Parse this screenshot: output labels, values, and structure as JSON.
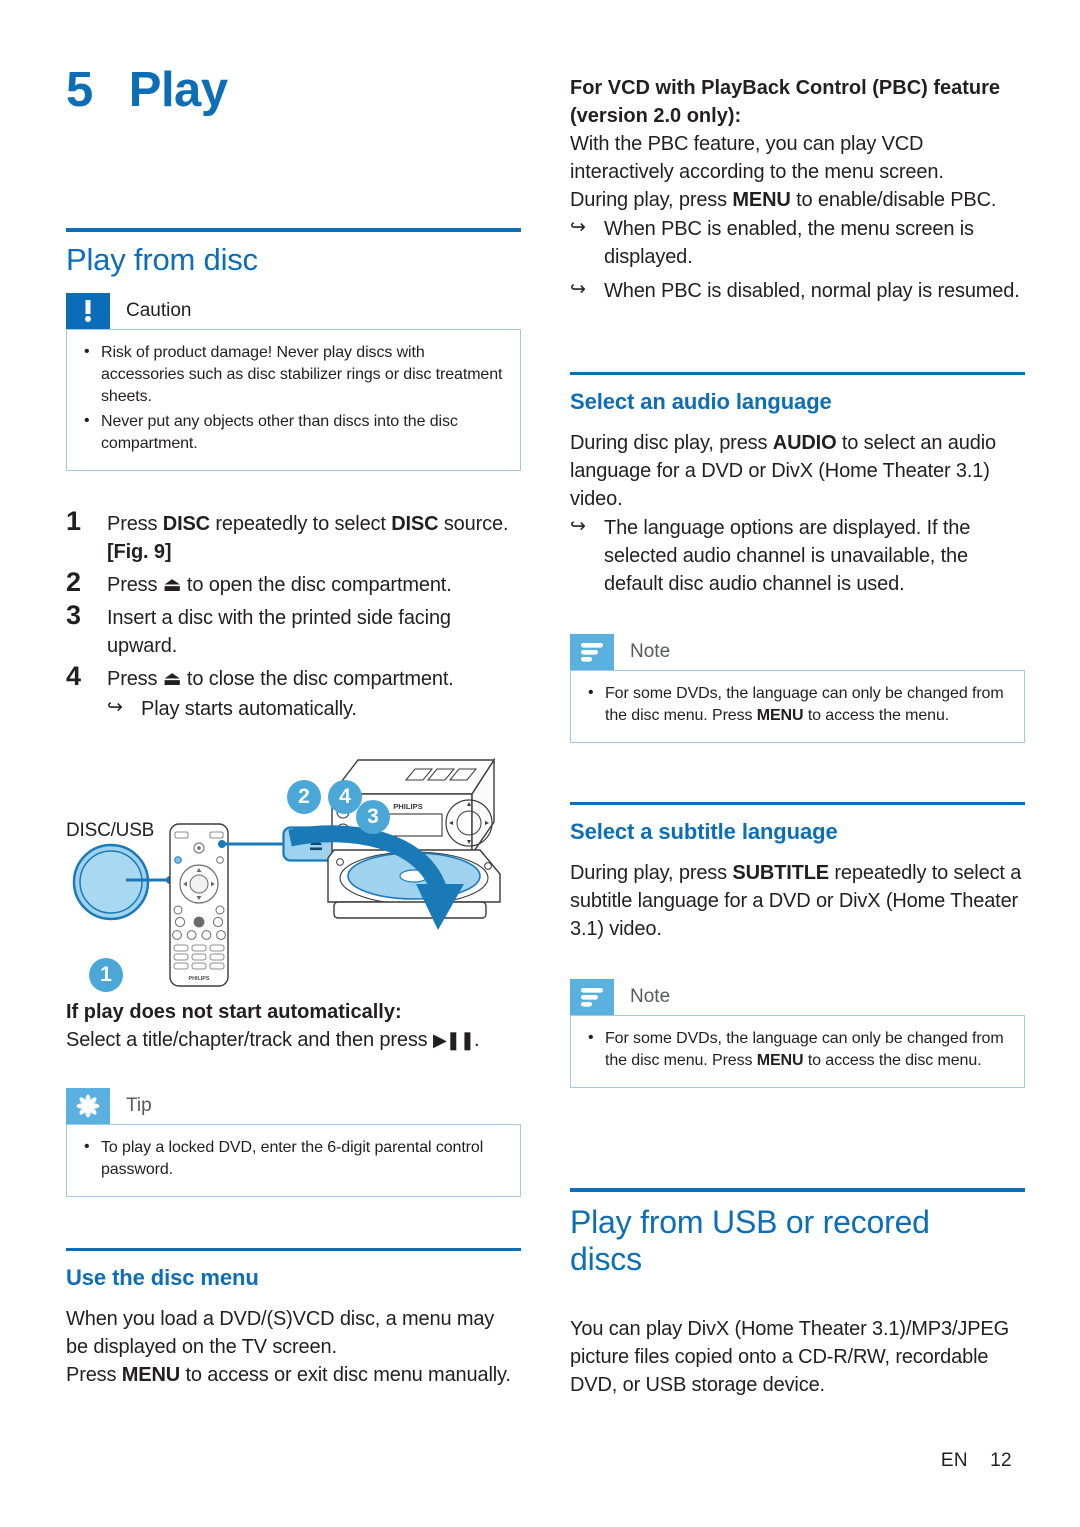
{
  "colors": {
    "accent_blue": "#0d6eb8",
    "light_blue": "#5ab0de",
    "callout_border": "#9fcbe8",
    "body_text": "#231f20"
  },
  "chapter": {
    "number": "5",
    "title": "Play"
  },
  "left_column": {
    "section_play_from_disc": {
      "heading": "Play from disc",
      "caution": {
        "icon": "caution-icon",
        "title": "Caution",
        "items": [
          "Risk of product damage! Never play discs with accessories such as disc stabilizer rings or disc treatment sheets.",
          "Never put any objects other than discs into the disc compartment."
        ]
      },
      "steps": [
        {
          "number": "1",
          "text_parts": [
            {
              "t": "Press ",
              "b": false
            },
            {
              "t": "DISC",
              "b": true
            },
            {
              "t": " repeatedly to select ",
              "b": false
            },
            {
              "t": "DISC",
              "b": true
            },
            {
              "t": " source. ",
              "b": false
            },
            {
              "t": "[Fig. 9]",
              "b": true
            }
          ]
        },
        {
          "number": "2",
          "text_parts": [
            {
              "t": "Press ⏏ to open the disc compartment.",
              "b": false
            }
          ]
        },
        {
          "number": "3",
          "text_parts": [
            {
              "t": "Insert a disc with the printed side facing upward.",
              "b": false
            }
          ]
        },
        {
          "number": "4",
          "text_parts": [
            {
              "t": "Press ⏏ to close the disc compartment.",
              "b": false
            }
          ],
          "arrow": "Play starts automatically."
        }
      ],
      "figure": {
        "name": "disc-loading-illustration",
        "disc_usb_label": "DISC/USB",
        "brand": "PHILIPS",
        "callouts": [
          "1",
          "2",
          "4",
          "3"
        ]
      },
      "if_play_heading": "If play does not start automatically:",
      "if_play_text": "Select a title/chapter/track and then press",
      "if_play_glyph": "▶❙❙",
      "tip": {
        "icon": "tip-icon",
        "title": "Tip",
        "items": [
          "To play a locked DVD, enter the 6-digit parental control password."
        ]
      }
    },
    "section_use_disc_menu": {
      "heading": "Use the disc menu",
      "paragraph_1": "When you load a DVD/(S)VCD disc, a menu may be displayed on the TV screen.",
      "paragraph_2_parts": [
        {
          "t": "Press ",
          "b": false
        },
        {
          "t": "MENU",
          "b": true
        },
        {
          "t": " to access or exit disc menu manually.",
          "b": false
        }
      ]
    }
  },
  "right_column": {
    "pbc": {
      "heading_line_1": "For VCD with PlayBack Control (PBC) feature",
      "heading_line_2": "(version 2.0 only):",
      "paragraph": "With the PBC feature, you can play VCD interactively according to the menu screen.",
      "paragraph_2_parts": [
        {
          "t": "During play, press ",
          "b": false
        },
        {
          "t": "MENU",
          "b": true
        },
        {
          "t": " to enable/disable PBC.",
          "b": false
        }
      ],
      "arrows": [
        "When PBC is enabled, the menu screen is displayed.",
        "When PBC is disabled, normal play is resumed."
      ]
    },
    "section_audio_language": {
      "heading": "Select an audio language",
      "paragraph_parts": [
        {
          "t": "During disc play, press ",
          "b": false
        },
        {
          "t": "AUDIO",
          "b": true
        },
        {
          "t": " to select an audio language for a DVD or DivX (Home Theater 3.1) video.",
          "b": false
        }
      ],
      "arrow": "The language options are displayed. If the selected audio channel is unavailable, the default disc audio channel is used.",
      "note": {
        "icon": "note-icon",
        "title": "Note",
        "items_parts": [
          [
            {
              "t": "For some DVDs, the language can only be changed from the disc menu. Press ",
              "b": false
            },
            {
              "t": "MENU",
              "b": true
            },
            {
              "t": " to access the menu.",
              "b": false
            }
          ]
        ]
      }
    },
    "section_subtitle_language": {
      "heading": "Select a subtitle language",
      "paragraph_parts": [
        {
          "t": "During play, press ",
          "b": false
        },
        {
          "t": "SUBTITLE",
          "b": true
        },
        {
          "t": " repeatedly to select a subtitle language for a DVD or DivX (Home Theater 3.1) video.",
          "b": false
        }
      ],
      "note": {
        "icon": "note-icon",
        "title": "Note",
        "items_parts": [
          [
            {
              "t": "For some DVDs, the language can only be changed from the disc menu. Press ",
              "b": false
            },
            {
              "t": "MENU",
              "b": true
            },
            {
              "t": " to access the disc menu.",
              "b": false
            }
          ]
        ]
      }
    },
    "section_usb": {
      "heading": "Play from USB or recored discs",
      "paragraph": "You can play DivX (Home Theater 3.1)/MP3/JPEG picture files copied onto a CD-R/RW, recordable DVD, or USB storage device."
    }
  },
  "footer": {
    "language": "EN",
    "page_number": "12"
  }
}
